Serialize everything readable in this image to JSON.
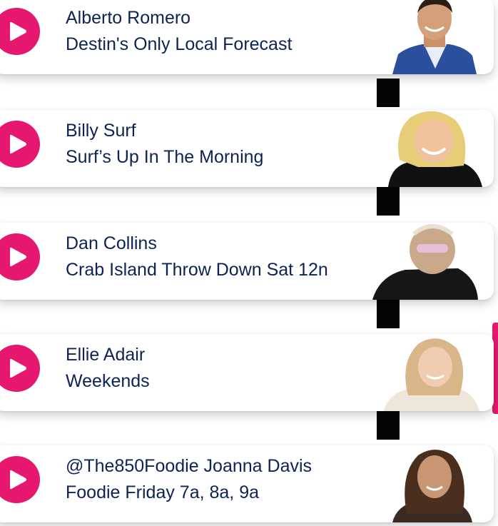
{
  "colors": {
    "accent": "#e5176f",
    "text": "#0d2353",
    "card_bg": "#ffffff"
  },
  "hosts": [
    {
      "name": "Alberto Romero",
      "show": "Destin's Only Local Forecast",
      "icon": "play-icon"
    },
    {
      "name": "Billy Surf",
      "show": "Surf’s Up In The Morning",
      "icon": "play-icon"
    },
    {
      "name": "Dan Collins",
      "show": "Crab Island Throw Down Sat 12n",
      "icon": "play-icon"
    },
    {
      "name": "Ellie Adair",
      "show": "Weekends",
      "icon": "play-icon"
    },
    {
      "name": "@The850Foodie Joanna Davis",
      "show": "Foodie Friday 7a, 8a, 9a",
      "icon": "play-icon"
    }
  ]
}
